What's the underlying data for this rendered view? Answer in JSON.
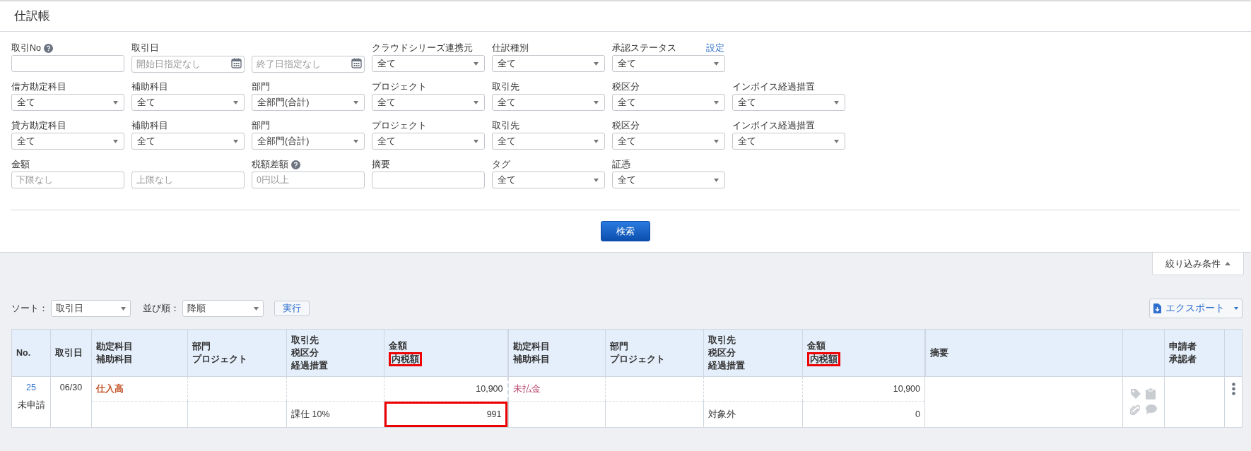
{
  "page_title": "仕訳帳",
  "filter_rows": [
    [
      {
        "label": "取引No",
        "help": true,
        "kind": "text"
      },
      {
        "label": "取引日",
        "kind": "date",
        "placeholder": "開始日指定なし"
      },
      {
        "kind": "date",
        "placeholder": "終了日指定なし"
      },
      {
        "label": "クラウドシリーズ連携元",
        "kind": "select",
        "value": "全て"
      },
      {
        "label": "仕訳種別",
        "kind": "select",
        "value": "全て"
      },
      {
        "label": "承認ステータス",
        "link": "設定",
        "kind": "select",
        "value": "全て"
      }
    ],
    [
      {
        "label": "借方勘定科目",
        "kind": "select",
        "value": "全て"
      },
      {
        "label": "補助科目",
        "kind": "select",
        "value": "全て"
      },
      {
        "label": "部門",
        "kind": "select",
        "value": "全部門(合計)"
      },
      {
        "label": "プロジェクト",
        "kind": "select",
        "value": "全て"
      },
      {
        "label": "取引先",
        "kind": "select",
        "value": "全て"
      },
      {
        "label": "税区分",
        "kind": "select",
        "value": "全て"
      },
      {
        "label": "インボイス経過措置",
        "kind": "select",
        "value": "全て"
      }
    ],
    [
      {
        "label": "貸方勘定科目",
        "kind": "select",
        "value": "全て"
      },
      {
        "label": "補助科目",
        "kind": "select",
        "value": "全て"
      },
      {
        "label": "部門",
        "kind": "select",
        "value": "全部門(合計)"
      },
      {
        "label": "プロジェクト",
        "kind": "select",
        "value": "全て"
      },
      {
        "label": "取引先",
        "kind": "select",
        "value": "全て"
      },
      {
        "label": "税区分",
        "kind": "select",
        "value": "全て"
      },
      {
        "label": "インボイス経過措置",
        "kind": "select",
        "value": "全て"
      }
    ],
    [
      {
        "label": "金額",
        "kind": "text",
        "placeholder": "下限なし"
      },
      {
        "kind": "text",
        "placeholder": "上限なし"
      },
      {
        "label": "税額差額",
        "help": true,
        "kind": "text",
        "placeholder": "0円以上"
      },
      {
        "label": "摘要",
        "kind": "text"
      },
      {
        "label": "タグ",
        "kind": "select",
        "value": "全て"
      },
      {
        "label": "証憑",
        "kind": "select",
        "value": "全て"
      }
    ]
  ],
  "search_button": "検索",
  "filter_toggle": {
    "label": "絞り込み条件",
    "expanded": true
  },
  "sort": {
    "label": "ソート：",
    "value": "取引日"
  },
  "order": {
    "label": "並び順：",
    "value": "降順"
  },
  "run_button": "実行",
  "export_button": "エクスポート",
  "table": {
    "columns": [
      {
        "kind": "text",
        "lines": [
          {
            "text": "No.",
            "boxed": false
          }
        ]
      },
      {
        "kind": "text",
        "lines": [
          {
            "text": "取引日",
            "boxed": false
          }
        ]
      },
      {
        "kind": "text",
        "lines": [
          {
            "text": "勘定科目",
            "boxed": false
          },
          {
            "text": "補助科目",
            "boxed": false
          }
        ]
      },
      {
        "kind": "text",
        "lines": [
          {
            "text": "部門",
            "boxed": false
          },
          {
            "text": "プロジェクト",
            "boxed": false
          }
        ]
      },
      {
        "kind": "text",
        "lines": [
          {
            "text": "取引先",
            "boxed": false
          },
          {
            "text": "税区分",
            "boxed": false
          },
          {
            "text": "経過措置",
            "boxed": false
          }
        ]
      },
      {
        "kind": "text",
        "lines": [
          {
            "text": "金額",
            "boxed": false
          },
          {
            "text": "内税額",
            "boxed": true
          }
        ]
      },
      {
        "kind": "text",
        "lines": [
          {
            "text": "勘定科目",
            "boxed": false
          },
          {
            "text": "補助科目",
            "boxed": false
          }
        ]
      },
      {
        "kind": "text",
        "lines": [
          {
            "text": "部門",
            "boxed": false
          },
          {
            "text": "プロジェクト",
            "boxed": false
          }
        ]
      },
      {
        "kind": "text",
        "lines": [
          {
            "text": "取引先",
            "boxed": false
          },
          {
            "text": "税区分",
            "boxed": false
          },
          {
            "text": "経過措置",
            "boxed": false
          }
        ]
      },
      {
        "kind": "text",
        "lines": [
          {
            "text": "金額",
            "boxed": false
          },
          {
            "text": "内税額",
            "boxed": true
          }
        ]
      },
      {
        "kind": "text",
        "lines": [
          {
            "text": "摘要",
            "boxed": false
          }
        ]
      },
      {
        "kind": "icons"
      },
      {
        "kind": "text",
        "lines": [
          {
            "text": "申請者",
            "boxed": false
          },
          {
            "text": "承認者",
            "boxed": false
          }
        ]
      },
      {
        "kind": "menu"
      }
    ],
    "rows": [
      {
        "no": "25",
        "status": "未申請",
        "date": "06/30",
        "debit": {
          "account": "仕入高",
          "color": "#c4562c",
          "amount": "10,900",
          "tax_category": "課仕 10%",
          "tax_amount": "991",
          "tax_amount_boxed": true
        },
        "credit": {
          "account": "未払金",
          "color": "#b94a72",
          "amount": "10,900",
          "tax_category": "対象外",
          "tax_amount": "0",
          "tax_amount_boxed": false
        }
      }
    ]
  }
}
